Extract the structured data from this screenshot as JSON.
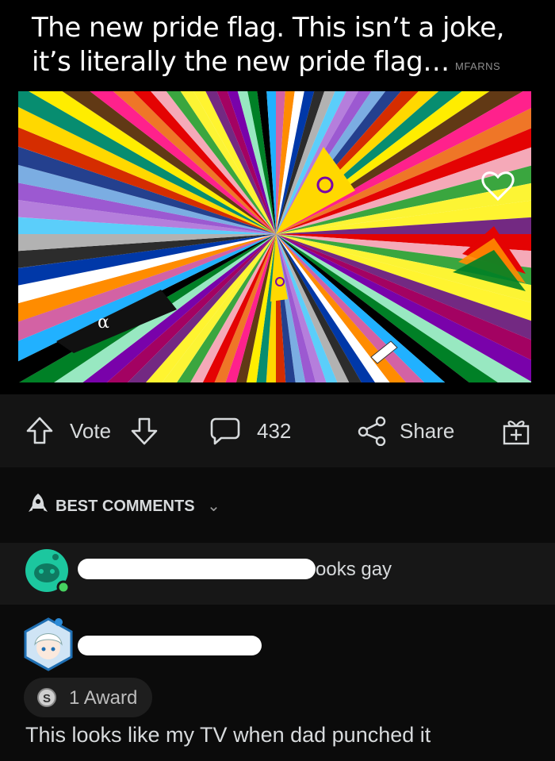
{
  "post": {
    "caption": "The new pride flag. This isn’t a joke, it’s literally the new pride flag…",
    "watermark": "MFARNS",
    "image_symbols": {
      "intersex_ring": "o",
      "alpha": "α"
    }
  },
  "actions": {
    "vote_label": "Vote",
    "comments_count": "432",
    "share_label": "Share",
    "upvote_icon": "arrow-up-icon",
    "downvote_icon": "arrow-down-icon",
    "comment_icon": "comment-bubble-icon",
    "share_icon": "share-icon",
    "award_icon": "gift-icon"
  },
  "comments_section": {
    "sort_label": "BEST COMMENTS",
    "sort_icon": "rocket-icon"
  },
  "comments": [
    {
      "text_fragment": "ooks gay"
    },
    {
      "award_label": "1 Award",
      "body": "This looks like my TV when dad punched it"
    }
  ],
  "colors": {
    "background": "#0b0b0b",
    "action_bar": "#141414",
    "text": "#d7dadc",
    "avatar_teal": "#1cc79f"
  }
}
